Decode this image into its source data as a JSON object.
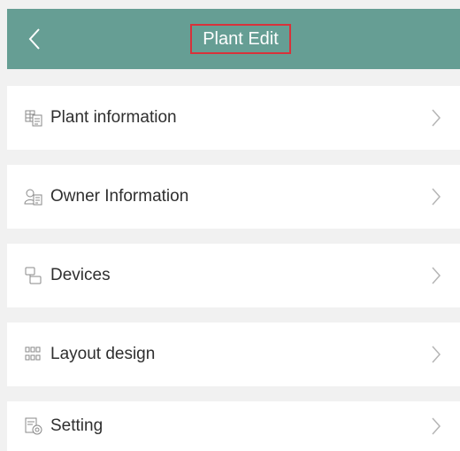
{
  "header": {
    "title": "Plant Edit",
    "back_icon": "back-chevron-icon",
    "background": "#669e94",
    "highlight_color": "#d8323a"
  },
  "menu": {
    "items": [
      {
        "label": "Plant information",
        "icon": "plant-info-icon"
      },
      {
        "label": "Owner Information",
        "icon": "owner-info-icon"
      },
      {
        "label": "Devices",
        "icon": "devices-icon"
      },
      {
        "label": "Layout design",
        "icon": "layout-grid-icon"
      },
      {
        "label": "Setting",
        "icon": "settings-icon"
      }
    ],
    "chevron_icon": "chevron-right-icon"
  }
}
